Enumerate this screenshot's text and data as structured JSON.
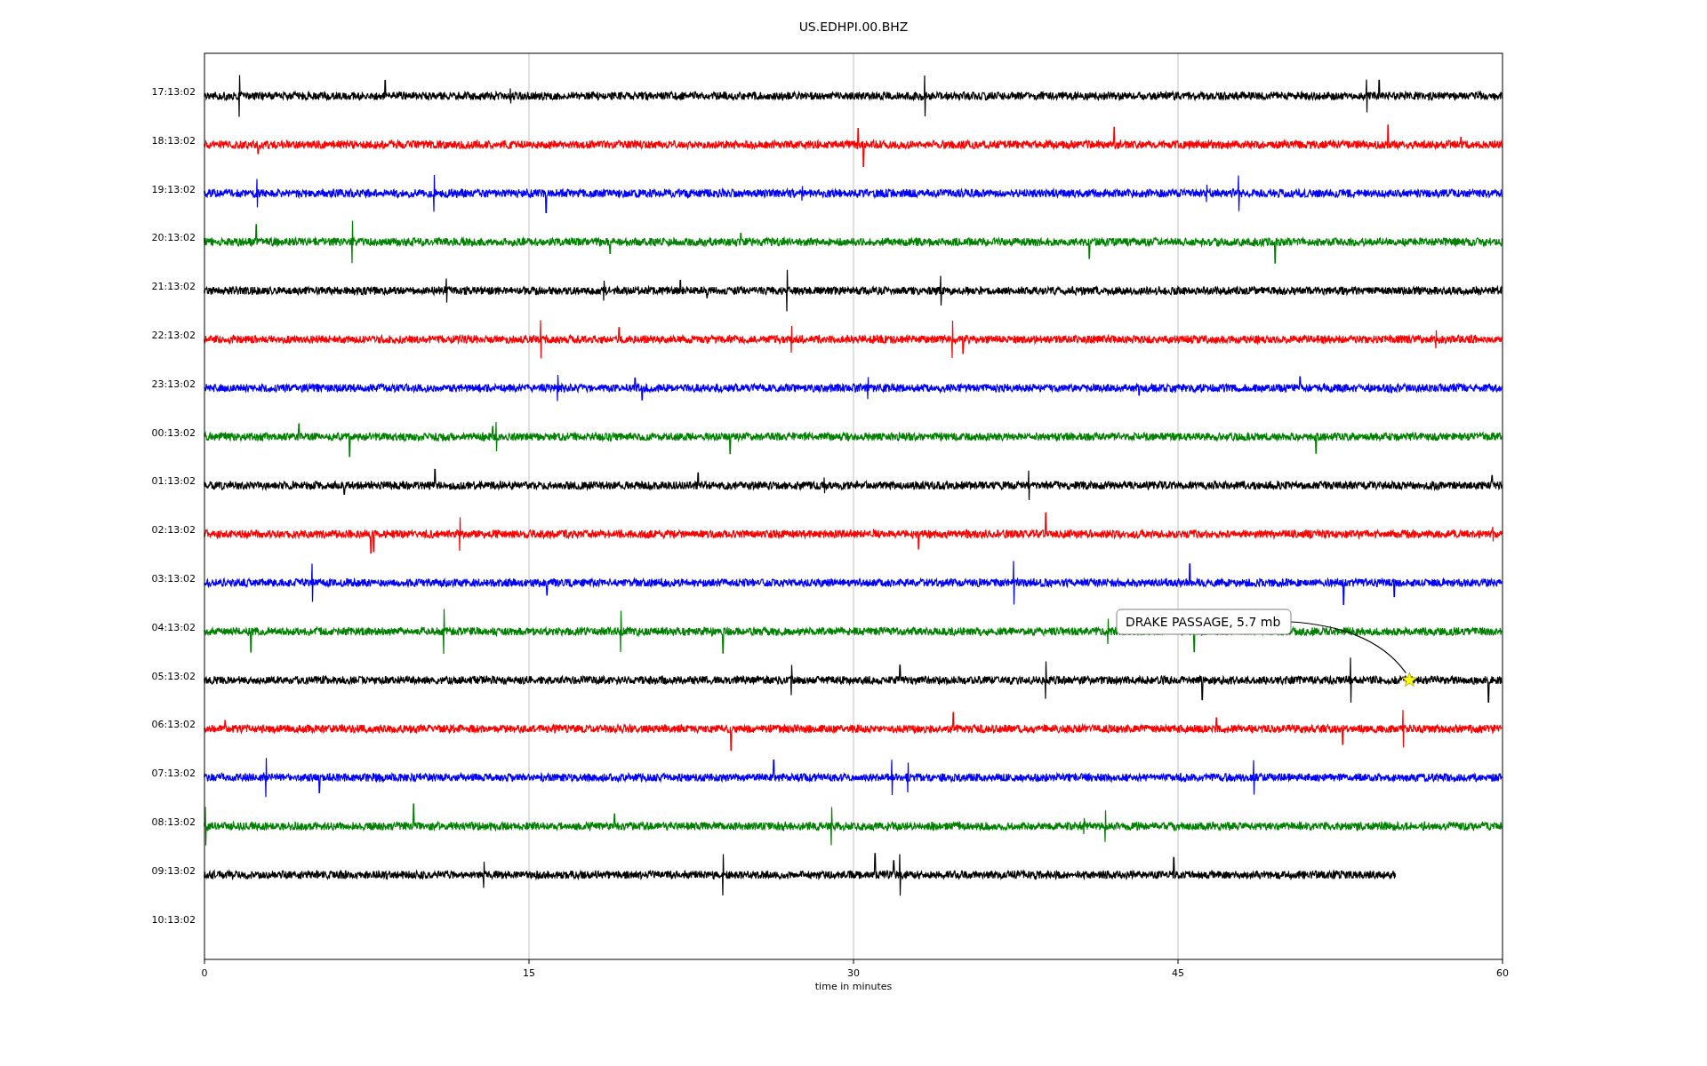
{
  "plot": {
    "title": "US.EDHPI.00.BHZ",
    "xlabel": "time in minutes",
    "xticks": [
      "0",
      "15",
      "30",
      "45",
      "60"
    ],
    "rows": [
      {
        "label": "17:13:02",
        "color": "#000000",
        "kind": "full"
      },
      {
        "label": "18:13:02",
        "color": "#ff0000",
        "kind": "full"
      },
      {
        "label": "19:13:02",
        "color": "#0000ff",
        "kind": "full"
      },
      {
        "label": "20:13:02",
        "color": "#008000",
        "kind": "full"
      },
      {
        "label": "21:13:02",
        "color": "#000000",
        "kind": "full"
      },
      {
        "label": "22:13:02",
        "color": "#ff0000",
        "kind": "full"
      },
      {
        "label": "23:13:02",
        "color": "#0000ff",
        "kind": "full"
      },
      {
        "label": "00:13:02",
        "color": "#008000",
        "kind": "full"
      },
      {
        "label": "01:13:02",
        "color": "#000000",
        "kind": "full"
      },
      {
        "label": "02:13:02",
        "color": "#ff0000",
        "kind": "full"
      },
      {
        "label": "03:13:02",
        "color": "#0000ff",
        "kind": "full"
      },
      {
        "label": "04:13:02",
        "color": "#008000",
        "kind": "full"
      },
      {
        "label": "05:13:02",
        "color": "#000000",
        "kind": "full"
      },
      {
        "label": "06:13:02",
        "color": "#ff0000",
        "kind": "full"
      },
      {
        "label": "07:13:02",
        "color": "#0000ff",
        "kind": "full"
      },
      {
        "label": "08:13:02",
        "color": "#008000",
        "kind": "full"
      },
      {
        "label": "09:13:02",
        "color": "#000000",
        "kind": "partial"
      },
      {
        "label": "10:13:02",
        "kind": "empty"
      }
    ],
    "annotation": {
      "text": "DRAKE PASSAGE, 5.7 mb"
    }
  }
}
